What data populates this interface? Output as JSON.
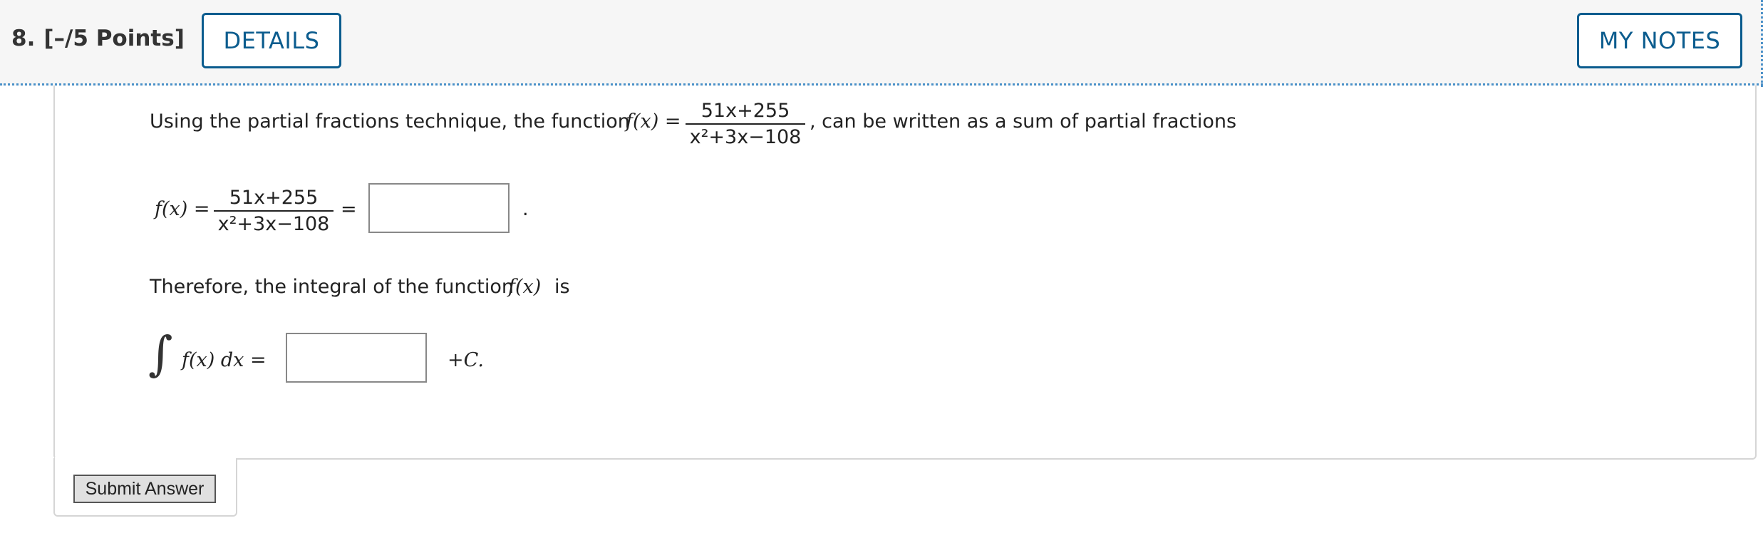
{
  "header": {
    "question_number": "8.",
    "points": "[–/5 Points]",
    "details_label": "DETAILS",
    "notes_label": "MY NOTES"
  },
  "question": {
    "intro_text": "Using the partial fractions technique, the function",
    "fx": "f(x) =",
    "numerator": "51x+255",
    "denominator": "x²+3x−108",
    "intro_suffix": ", can be written as a sum of partial fractions",
    "line2_fx": "f(x) =",
    "line2_equals": "=",
    "line2_period": ".",
    "therefore_text": "Therefore, the integral of the function",
    "therefore_fx": "f(x)",
    "therefore_is": "is",
    "integral_expr": "f(x)  dx =",
    "plus_c": "+C."
  },
  "footer": {
    "submit_label": "Submit Answer"
  },
  "colors": {
    "accent": "#0b5c8e",
    "header_bg": "#f6f6f6",
    "dotted_border": "#4a90c8"
  }
}
